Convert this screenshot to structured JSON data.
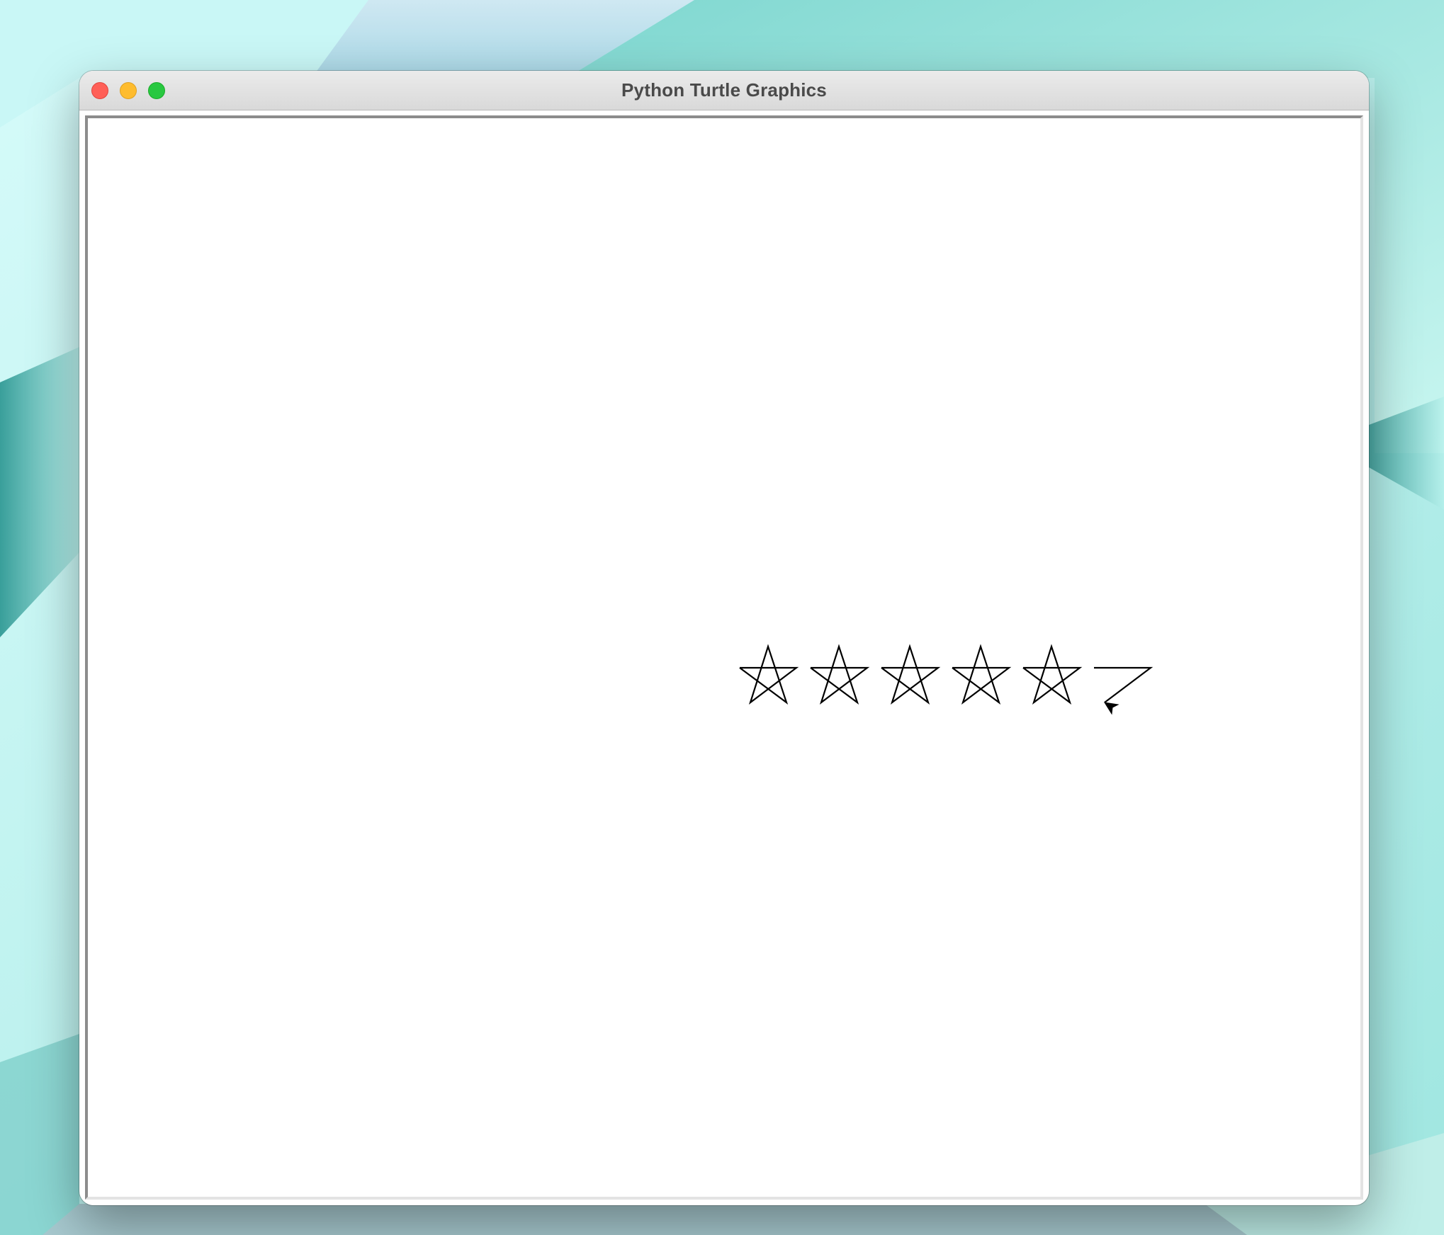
{
  "window": {
    "title": "Python Turtle Graphics"
  },
  "traffic_lights": {
    "close_color": "#ff5f57",
    "minimize_color": "#febc2e",
    "maximize_color": "#28c840"
  },
  "canvas": {
    "background": "#ffffff",
    "pen_color": "#000000",
    "stars_drawn": 5,
    "partial_star_segments": 2,
    "turtle_shape": "classic-arrow"
  }
}
